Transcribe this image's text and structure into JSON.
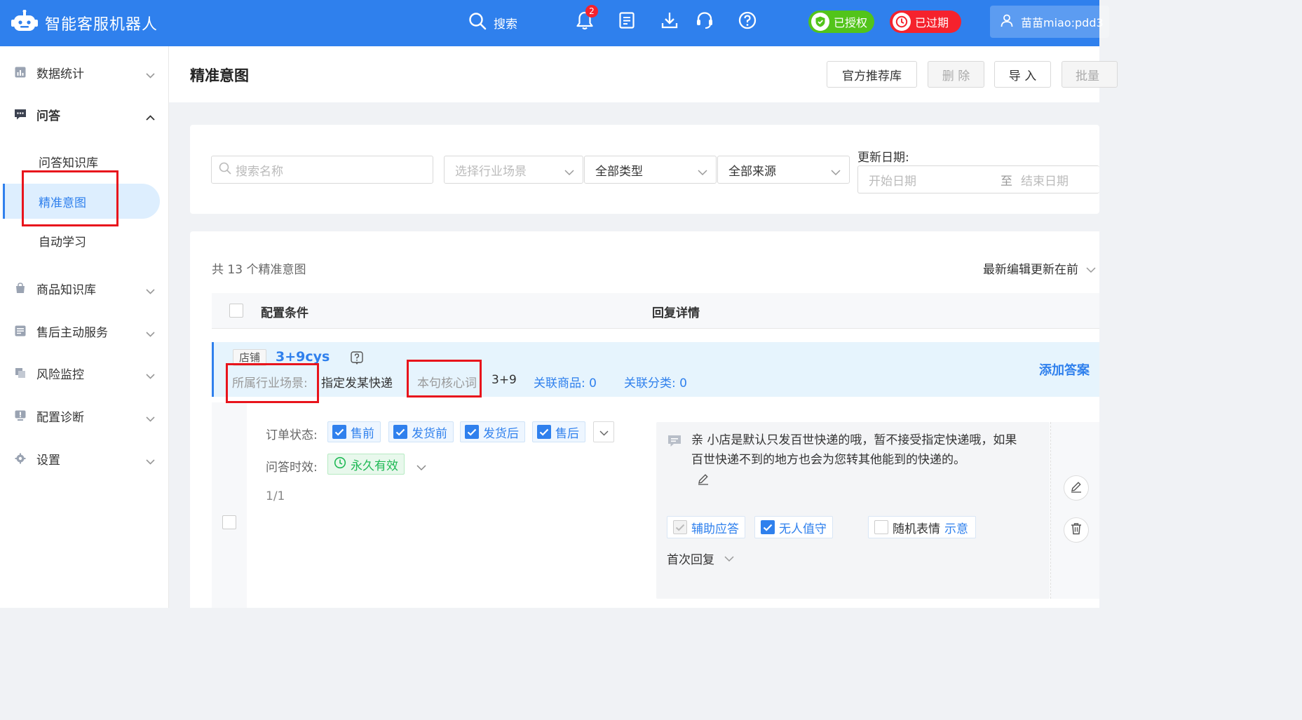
{
  "header": {
    "app_title": "智能客服机器人",
    "search_label": "搜索",
    "notification_count": "2",
    "authorized_label": "已授权",
    "expired_label": "已过期",
    "user_name": "苗苗miao:pdd3"
  },
  "sidebar": {
    "items": [
      {
        "label": "数据统计",
        "icon": "bar-chart-icon"
      },
      {
        "label": "问答",
        "icon": "chat-icon"
      },
      {
        "label": "商品知识库",
        "icon": "bag-icon"
      },
      {
        "label": "售后主动服务",
        "icon": "list-icon"
      },
      {
        "label": "风险监控",
        "icon": "monitor-icon"
      },
      {
        "label": "配置诊断",
        "icon": "diagnose-icon"
      },
      {
        "label": "设置",
        "icon": "gear-icon"
      }
    ],
    "sub_items": [
      {
        "label": "问答知识库"
      },
      {
        "label": "精准意图"
      },
      {
        "label": "自动学习"
      }
    ]
  },
  "page": {
    "title": "精准意图",
    "buttons": {
      "official": "官方推荐库",
      "delete": "删 除",
      "import": "导 入",
      "batch": "批量"
    }
  },
  "filters": {
    "search_placeholder": "搜索名称",
    "industry_placeholder": "选择行业场景",
    "type_value": "全部类型",
    "source_value": "全部来源",
    "date_label": "更新日期:",
    "start_placeholder": "开始日期",
    "date_sep": "至",
    "end_placeholder": "结束日期"
  },
  "list": {
    "total": "共 13 个精准意图",
    "sort": "最新编辑更新在前",
    "col_condition": "配置条件",
    "col_reply": "回复详情"
  },
  "row": {
    "store_tag": "店铺",
    "name": "3+9cys",
    "industry_label": "所属行业场景:",
    "industry_value": "指定发某快递",
    "core_label": "本句核心词",
    "core_value": "3+9",
    "related_goods": "关联商品: 0",
    "related_category": "关联分类: 0",
    "add_answer": "添加答案",
    "order_status_label": "订单状态:",
    "statuses": [
      "售前",
      "发货前",
      "发货后",
      "售后"
    ],
    "validity_label": "问答时效:",
    "validity_value": "永久有效",
    "pager": "1/1",
    "reply_text": "亲 小店是默认只发百世快递的哦，暂不接受指定快递哦，如果百世快递不到的地方也会为您转其他能到的快递的。",
    "opt_assist": "辅助应答",
    "opt_unattended": "无人值守",
    "opt_random_emoji": "随机表情",
    "opt_example": "示意",
    "first_reply": "首次回复"
  },
  "colors": {
    "primary": "#2f80ed",
    "success": "#52c41a",
    "danger": "#f5222d",
    "annotation": "#e8141c"
  }
}
